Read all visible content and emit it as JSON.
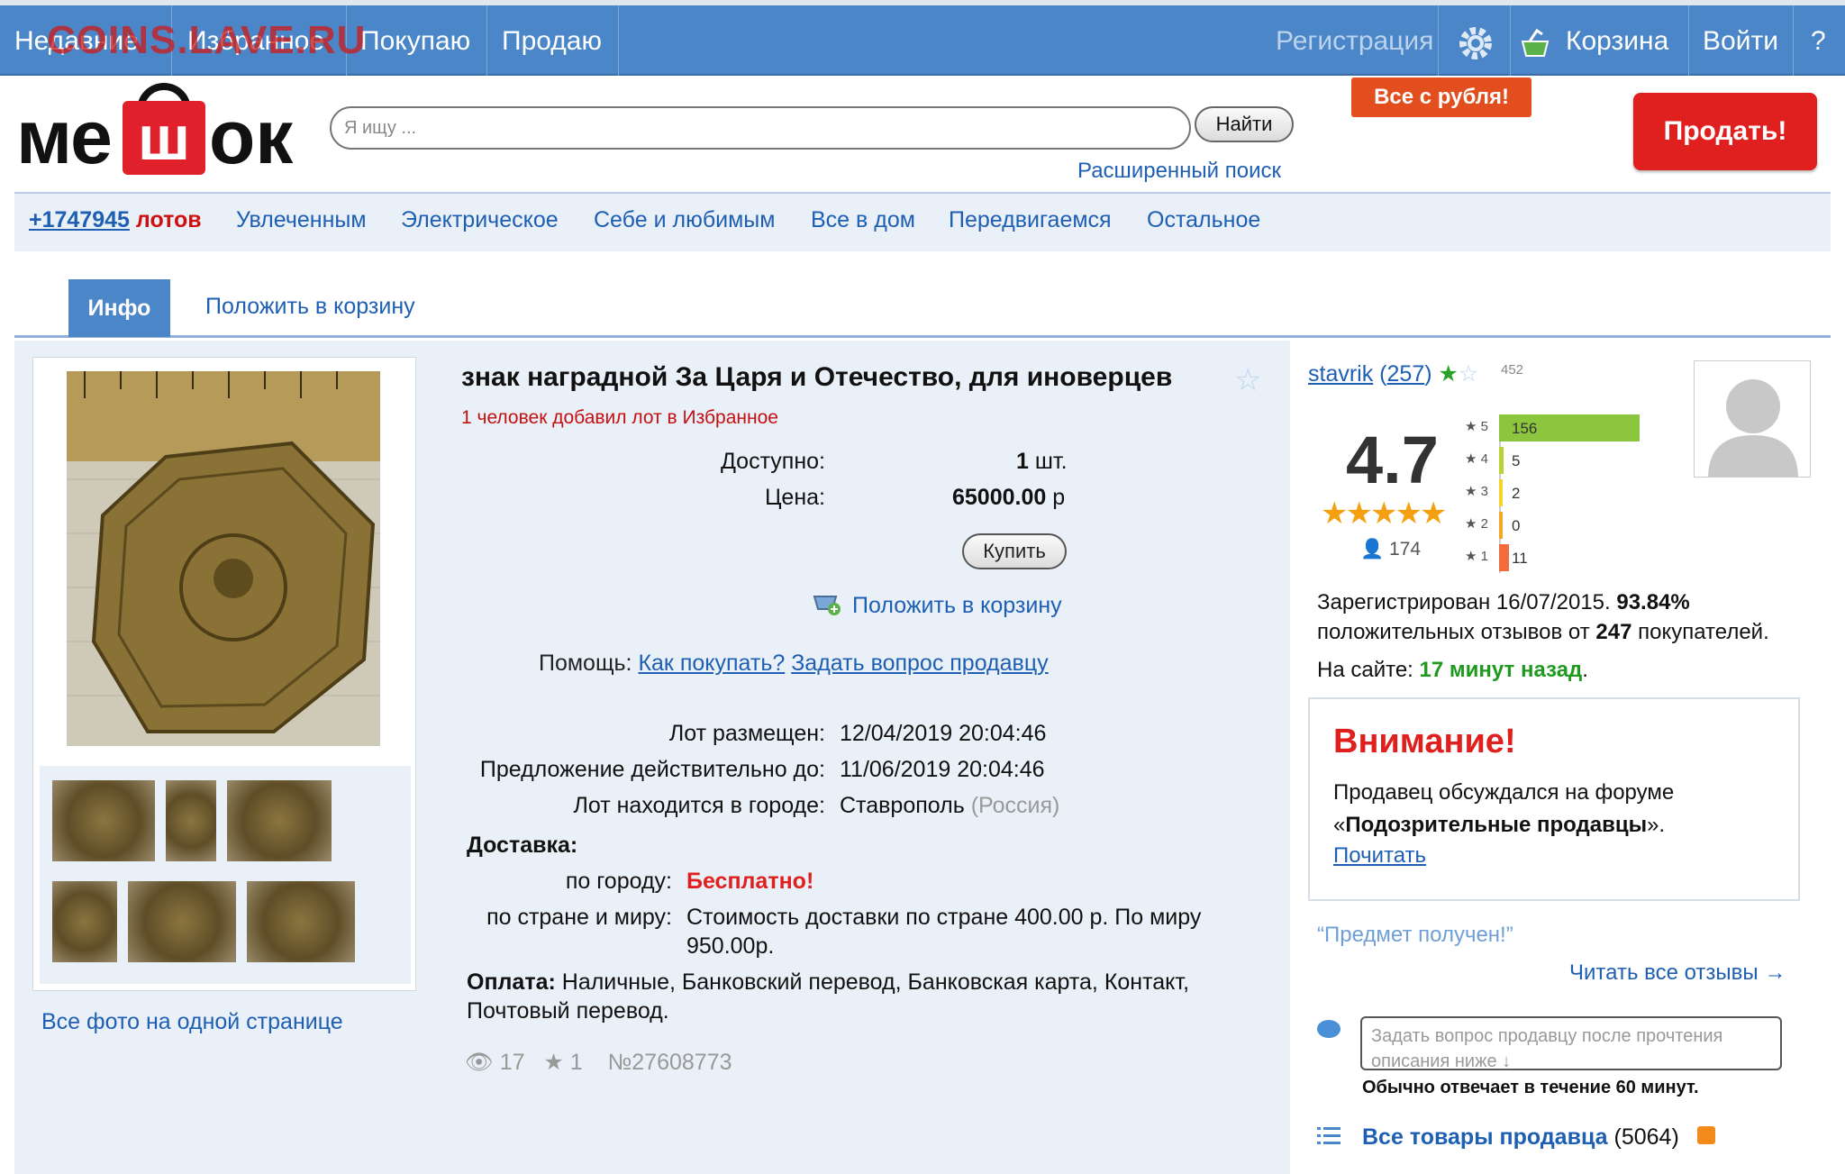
{
  "topbar": {
    "watermark": "COINS.LAVE.RU",
    "nav": [
      "Недавние",
      "Избранное",
      "Покупаю",
      "Продаю"
    ],
    "register": "Регистрация",
    "cart": "Корзина",
    "login": "Войти",
    "help": "?",
    "promo": "Все с рубля!"
  },
  "header": {
    "logo_left": "ме",
    "logo_bag": "ш",
    "logo_right": "ок",
    "search_placeholder": "Я ищу ...",
    "find_button": "Найти",
    "advanced_search": "Расширенный поиск",
    "sell_button": "Продать!"
  },
  "categories": {
    "lots_count": "+1747945",
    "lots_word": "лотов",
    "items": [
      "Увлеченным",
      "Электрическое",
      "Себе и любимым",
      "Все в дом",
      "Передвигаемся",
      "Остальное"
    ]
  },
  "tabs": {
    "info": "Инфо",
    "add_to_cart": "Положить в корзину"
  },
  "lot": {
    "title": "знак наградной За Царя и Отечество, для иноверцев",
    "fav_note": "1 человек добавил лот в Избранное",
    "available_label": "Доступно:",
    "available_qty": "1",
    "available_unit": "шт.",
    "price_label": "Цена:",
    "price": "65000.00",
    "currency": "р",
    "buy_button": "Купить",
    "cart_link": "Положить в корзину",
    "help_label": "Помощь:",
    "help_how": "Как покупать?",
    "help_ask": "Задать вопрос продавцу",
    "posted_label": "Лот размещен:",
    "posted": "12/04/2019 20:04:46",
    "valid_label": "Предложение действительно до:",
    "valid": "11/06/2019 20:04:46",
    "city_label": "Лот находится в городе:",
    "city": "Ставрополь",
    "country": "(Россия)",
    "delivery_label": "Доставка:",
    "city_delivery_label": "по городу:",
    "city_delivery": "Бесплатно!",
    "world_delivery_label": "по стране и миру:",
    "world_delivery_1": "Стоимость доставки по стране 400.00 р. По миру",
    "world_delivery_2": "950.00р.",
    "payment_label": "Оплата:",
    "payment_1": "Наличные, Банковский перевод, Банковская карта, Контакт,",
    "payment_2": "Почтовый перевод.",
    "views": "17",
    "stars": "1",
    "lot_number": "№27608773",
    "all_photos": "Все фото на одной странице"
  },
  "seller": {
    "name": "stavrik",
    "reviews_link": "257",
    "badge_count": "452",
    "rating": "4.7",
    "votes": "174",
    "rating_bars": [
      {
        "label": "5",
        "count": 156
      },
      {
        "label": "4",
        "count": 5
      },
      {
        "label": "3",
        "count": 2
      },
      {
        "label": "2",
        "count": 0
      },
      {
        "label": "1",
        "count": 11
      }
    ],
    "registered_prefix": "Зарегистрирован 16/07/2015.",
    "positive_pct": "93.84%",
    "positive_text": "положительных отзывов от",
    "buyers_count": "247",
    "buyers_word": "покупателей.",
    "online_prefix": "На сайте:",
    "online_time": "17 минут назад",
    "warning_title": "Внимание!",
    "warning_text_1": "Продавец обсуждался на форуме",
    "warning_text_2": "Подозрительные продавцы",
    "warning_link": "Почитать",
    "review_snippet": "“Предмет получен!”",
    "read_all": "Читать все отзывы →",
    "ask_placeholder": "Задать вопрос продавцу после прочтения описания ниже ↓",
    "reply_time": "Обычно отвечает в течение 60 минут.",
    "all_goods": "Все товары продавца",
    "goods_count": "(5064)"
  },
  "colors": {
    "topbar": "#4a86c8",
    "sell_red": "#e0201e",
    "link": "#1e5fb3",
    "bar5": "#8cc63f",
    "bar4": "#b5d334",
    "bar3": "#f5d327",
    "bar2": "#f5a623",
    "bar1": "#f26b3a"
  }
}
